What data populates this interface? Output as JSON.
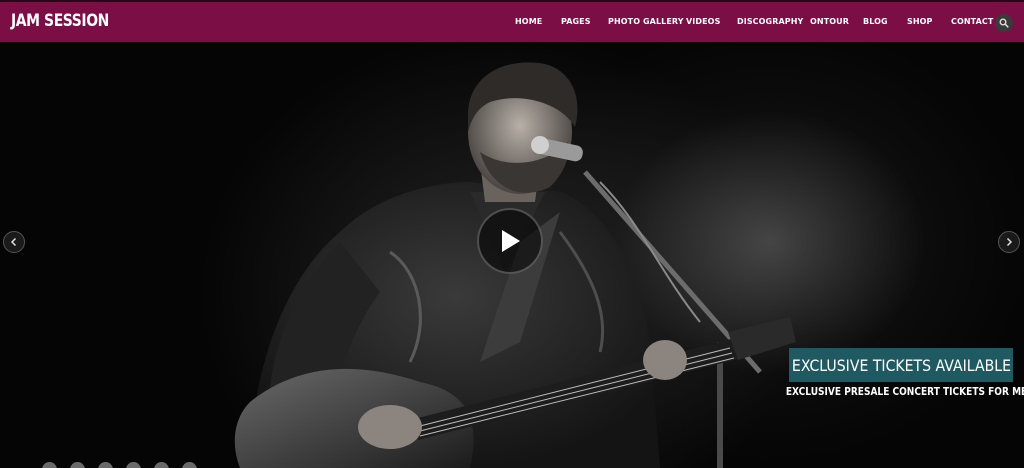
{
  "header": {
    "logo": "JAM SESSION",
    "nav": [
      {
        "label": "HOME"
      },
      {
        "label": "PAGES"
      },
      {
        "label": "PHOTO GALLERY"
      },
      {
        "label": "VIDEOS"
      },
      {
        "label": "DISCOGRAPHY"
      },
      {
        "label": "ONTOUR"
      },
      {
        "label": "BLOG"
      },
      {
        "label": "SHOP"
      },
      {
        "label": "CONTACT"
      }
    ],
    "search_icon": "search-icon",
    "brand_color": "#7a0e45"
  },
  "hero": {
    "caption_title": "EXCLUSIVE TICKETS AVAILABLE",
    "caption_subtitle": "EXCLUSIVE PRESALE CONCERT TICKETS FOR MEMBERS ONLY",
    "caption_color": "#1f5a62",
    "play_icon": "play-icon",
    "prev_icon": "chevron-left-icon",
    "next_icon": "chevron-right-icon",
    "slide_count": 6
  }
}
